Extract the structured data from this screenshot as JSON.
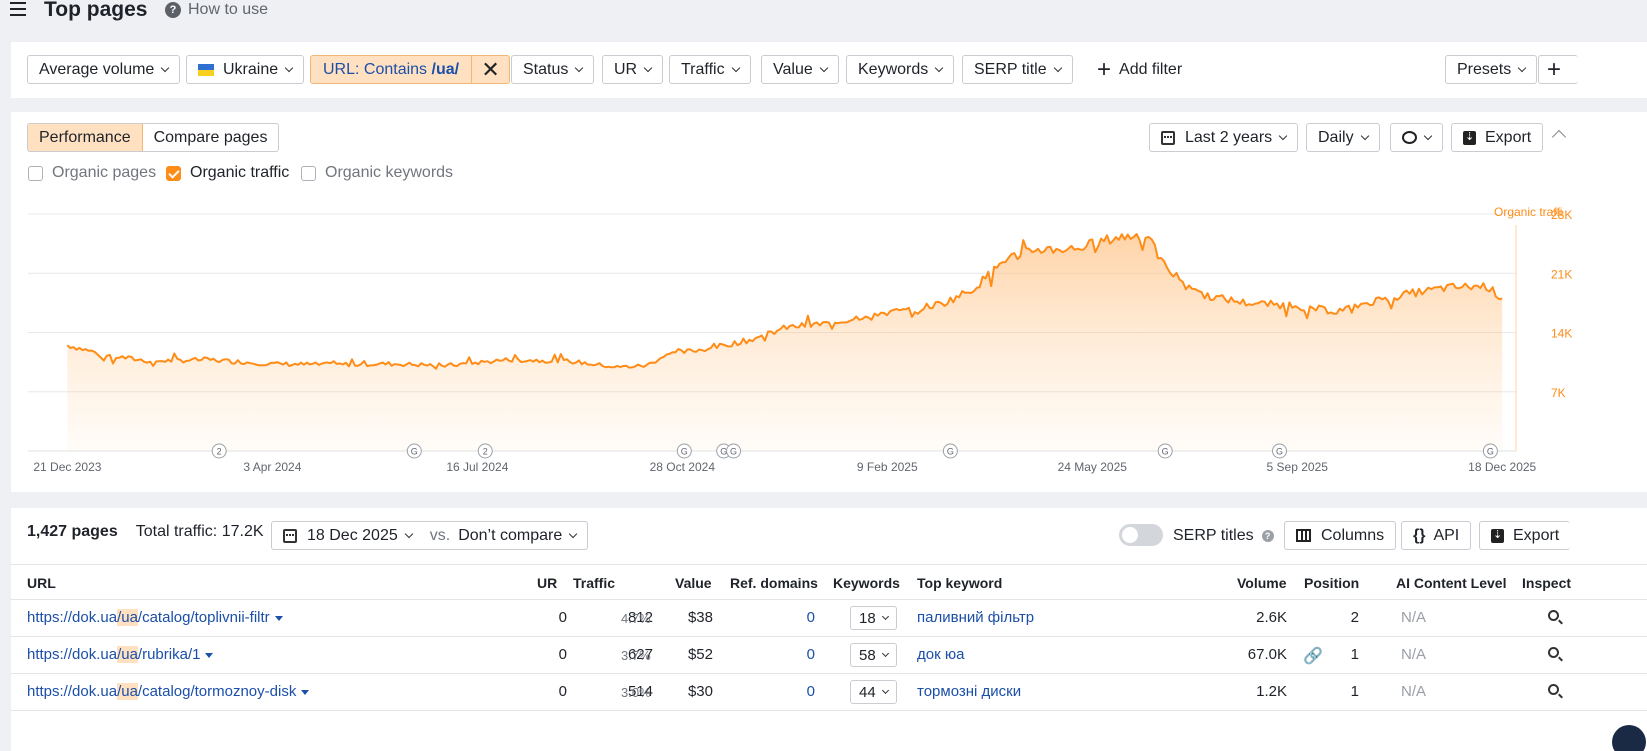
{
  "header": {
    "title": "Top pages",
    "how_to": "How to use"
  },
  "filters": {
    "average_volume": "Average volume",
    "country": "Ukraine",
    "url_prefix": "URL: Contains ",
    "url_value": "/ua/",
    "status": "Status",
    "ur": "UR",
    "traffic": "Traffic",
    "value": "Value",
    "keywords": "Keywords",
    "serp_title": "SERP title",
    "add_filter": "Add filter",
    "presets": "Presets"
  },
  "performance": {
    "tabs": [
      "Performance",
      "Compare pages"
    ],
    "range": "Last 2 years",
    "interval": "Daily",
    "export": "Export",
    "metrics": [
      "Organic pages",
      "Organic traffic",
      "Organic keywords"
    ],
    "active_metric": "Organic traffic"
  },
  "chart_data": {
    "type": "area",
    "series_label": "Organic traffi",
    "y_ticks": [
      "28K",
      "21K",
      "14K",
      "7K"
    ],
    "x_ticks": [
      "21 Dec 2023",
      "3 Apr 2024",
      "16 Jul 2024",
      "28 Oct 2024",
      "9 Feb 2025",
      "24 May 2025",
      "5 Sep 2025",
      "18 Dec 2025"
    ],
    "ylim": [
      0,
      28000
    ],
    "line_color": "#ff8c17",
    "points": [
      [
        "2023-12-21",
        12500
      ],
      [
        "2024-01-10",
        11300
      ],
      [
        "2024-02-01",
        10600
      ],
      [
        "2024-03-01",
        10800
      ],
      [
        "2024-04-01",
        10300
      ],
      [
        "2024-05-01",
        10200
      ],
      [
        "2024-06-01",
        10300
      ],
      [
        "2024-07-01",
        10100
      ],
      [
        "2024-08-01",
        10800
      ],
      [
        "2024-09-01",
        10600
      ],
      [
        "2024-09-25",
        9900
      ],
      [
        "2024-10-10",
        10100
      ],
      [
        "2024-10-20",
        11400
      ],
      [
        "2024-11-10",
        12100
      ],
      [
        "2024-12-01",
        13100
      ],
      [
        "2024-12-20",
        14600
      ],
      [
        "2025-01-15",
        15200
      ],
      [
        "2025-02-01",
        16200
      ],
      [
        "2025-02-20",
        16600
      ],
      [
        "2025-03-10",
        17500
      ],
      [
        "2025-03-25",
        19200
      ],
      [
        "2025-04-10",
        22700
      ],
      [
        "2025-04-25",
        23800
      ],
      [
        "2025-05-15",
        23900
      ],
      [
        "2025-06-05",
        25200
      ],
      [
        "2025-06-20",
        25600
      ],
      [
        "2025-07-01",
        21400
      ],
      [
        "2025-07-20",
        18400
      ],
      [
        "2025-08-10",
        17500
      ],
      [
        "2025-09-01",
        17200
      ],
      [
        "2025-09-25",
        16500
      ],
      [
        "2025-10-15",
        17800
      ],
      [
        "2025-11-01",
        18600
      ],
      [
        "2025-11-20",
        19300
      ],
      [
        "2025-12-10",
        19500
      ],
      [
        "2025-12-18",
        18000
      ]
    ],
    "annotations": [
      {
        "date": "2024-03-07",
        "label": "2"
      },
      {
        "date": "2024-06-14",
        "label": "G"
      },
      {
        "date": "2024-07-20",
        "label": "2"
      },
      {
        "date": "2024-10-29",
        "label": "G"
      },
      {
        "date": "2024-11-18",
        "label": "G"
      },
      {
        "date": "2024-11-23",
        "label": "G"
      },
      {
        "date": "2025-03-13",
        "label": "G"
      },
      {
        "date": "2025-06-30",
        "label": "G"
      },
      {
        "date": "2025-08-27",
        "label": "G"
      },
      {
        "date": "2025-12-12",
        "label": "G"
      }
    ]
  },
  "table": {
    "count": "1,427 pages",
    "total_traffic": "Total traffic: 17.2K",
    "date": "18 Dec 2025",
    "vs": "vs.",
    "compare": "Don’t compare",
    "serp_titles": "SERP titles",
    "columns_btn": "Columns",
    "api_btn": "API",
    "export_btn": "Export",
    "headers": [
      "URL",
      "UR",
      "Traffic",
      "Value",
      "Ref. domains",
      "Keywords",
      "Top keyword",
      "Volume",
      "Position",
      "AI Content Level",
      "Inspect"
    ],
    "rows": [
      {
        "url_a": "https://dok.ua",
        "url_hl": "/ua",
        "url_b": "/catalog/toplivnii-filtr",
        "ur": "0",
        "traffic": "812",
        "pct": "4.7%",
        "value": "$38",
        "ref": "0",
        "kw": "18",
        "top": "паливний фільтр",
        "volume": "2.6K",
        "pos": "2",
        "ai": "N/A"
      },
      {
        "url_a": "https://dok.ua",
        "url_hl": "/ua",
        "url_b": "/rubrika/1",
        "ur": "0",
        "traffic": "627",
        "pct": "3.7%",
        "value": "$52",
        "ref": "0",
        "kw": "58",
        "top": "док юа",
        "volume": "67.0K",
        "pos": "1",
        "ai": "N/A"
      },
      {
        "url_a": "https://dok.ua",
        "url_hl": "/ua",
        "url_b": "/catalog/tormoznoy-disk",
        "ur": "0",
        "traffic": "514",
        "pct": "3.0%",
        "value": "$30",
        "ref": "0",
        "kw": "44",
        "top": "тормозні диски",
        "volume": "1.2K",
        "pos": "1",
        "ai": "N/A"
      }
    ]
  }
}
